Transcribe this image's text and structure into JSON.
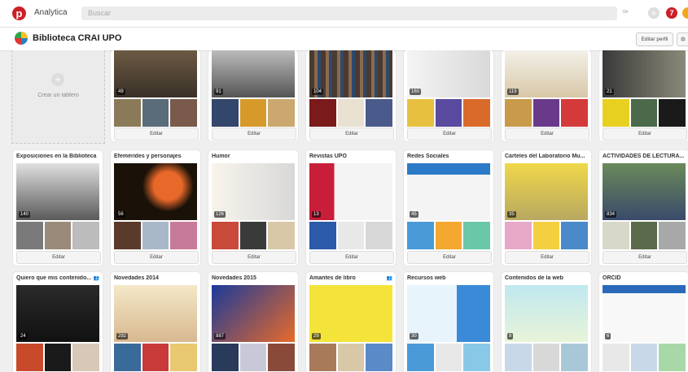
{
  "app": {
    "title": "Analytica",
    "logo_letter": "p"
  },
  "search": {
    "placeholder": "Buscar"
  },
  "toolbar": {
    "menu_icon": "≡▪",
    "notifications": "7"
  },
  "profile": {
    "name": "Biblioteca CRAI UPO",
    "edit_label": "Editar perfil"
  },
  "create_board": {
    "label": "Crear un tablero"
  },
  "row1": [
    {
      "count": "49",
      "edit": "Editar"
    },
    {
      "count": "91",
      "edit": "Editar"
    },
    {
      "count": "104",
      "edit": "Editar"
    },
    {
      "count": "160",
      "edit": "Editar"
    },
    {
      "count": "119",
      "edit": "Editar"
    },
    {
      "count": "21",
      "edit": "Editar"
    }
  ],
  "row2": [
    {
      "title": "Exposiciones en la Biblioteca",
      "count": "140",
      "edit": "Editar"
    },
    {
      "title": "Efemérides y personajes",
      "count": "56",
      "edit": "Editar"
    },
    {
      "title": "Humor",
      "count": "126",
      "edit": "Editar"
    },
    {
      "title": "Revistas UPO",
      "count": "13",
      "edit": "Editar"
    },
    {
      "title": "Redes Sociales",
      "count": "45",
      "edit": "Editar"
    },
    {
      "title": "Carteles del Laboratorio Mu...",
      "count": "35",
      "edit": "Editar"
    },
    {
      "title": "ACTIVIDADES DE LECTURA...",
      "count": "834",
      "edit": "Editar"
    }
  ],
  "row3": [
    {
      "title": "Quiero que mis contenido...",
      "count": "24",
      "group": true
    },
    {
      "title": "Novedades 2014",
      "count": "292",
      "group": false
    },
    {
      "title": "Novedades 2015",
      "count": "887",
      "group": false
    },
    {
      "title": "Amantes de libro",
      "count": "29",
      "group": true
    },
    {
      "title": "Recursos web",
      "count": "30",
      "group": false
    },
    {
      "title": "Contenidos de la web",
      "count": "8",
      "group": false
    },
    {
      "title": "ORCID",
      "count": "6",
      "group": false
    }
  ]
}
